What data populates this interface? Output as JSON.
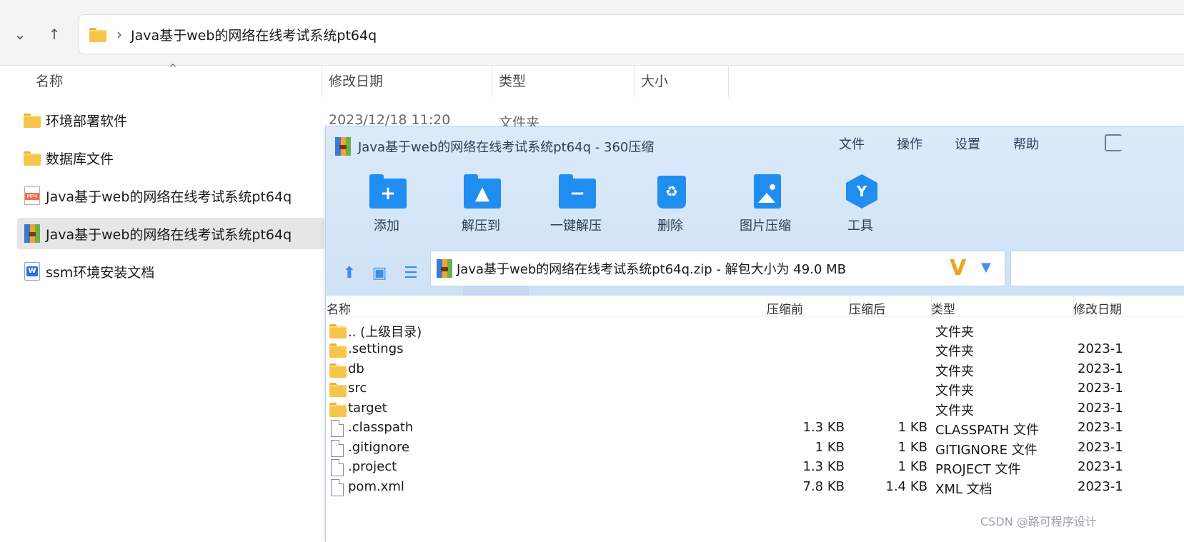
{
  "explorer": {
    "path": "Java基于web的网络在线考试系统pt64q",
    "columns": {
      "name": "名称",
      "modified": "修改日期",
      "type": "类型",
      "size": "大小"
    },
    "items": [
      {
        "name": "环境部署软件",
        "date": "2023/12/18 11:20",
        "type": "文件夹",
        "icon": "folder-icon"
      },
      {
        "name": "数据库文件",
        "icon": "folder-icon"
      },
      {
        "name": "Java基于web的网络在线考试系统pt64q",
        "icon": "mp4-file-icon"
      },
      {
        "name": "Java基于web的网络在线考试系统pt64q",
        "icon": "zip-archive-icon"
      },
      {
        "name": "ssm环境安装文档",
        "icon": "word-doc-icon"
      }
    ]
  },
  "zip": {
    "title": "Java基于web的网络在线考试系统pt64q - 360压缩",
    "menu": [
      "文件",
      "操作",
      "设置",
      "帮助"
    ],
    "tools": [
      {
        "label": "添加",
        "icon": "add-folder-icon"
      },
      {
        "label": "解压到",
        "icon": "extract-to-icon"
      },
      {
        "label": "一键解压",
        "icon": "one-click-extract-icon"
      },
      {
        "label": "删除",
        "icon": "delete-icon"
      },
      {
        "label": "图片压缩",
        "icon": "image-compress-icon"
      },
      {
        "label": "工具",
        "icon": "tools-icon"
      }
    ],
    "path_text": "Java基于web的网络在线考试系统pt64q.zip - 解包大小为 49.0 MB",
    "columns": {
      "name": "名称",
      "before": "压缩前",
      "after": "压缩后",
      "type": "类型",
      "modified": "修改日期"
    },
    "rows": [
      {
        "name": ".. (上级目录)",
        "before": "",
        "after": "",
        "type": "文件夹",
        "date": "",
        "icon": "folder-icon"
      },
      {
        "name": ".settings",
        "before": "",
        "after": "",
        "type": "文件夹",
        "date": "2023-1",
        "icon": "folder-icon"
      },
      {
        "name": "db",
        "before": "",
        "after": "",
        "type": "文件夹",
        "date": "2023-1",
        "icon": "folder-icon"
      },
      {
        "name": "src",
        "before": "",
        "after": "",
        "type": "文件夹",
        "date": "2023-1",
        "icon": "folder-icon"
      },
      {
        "name": "target",
        "before": "",
        "after": "",
        "type": "文件夹",
        "date": "2023-1",
        "icon": "folder-icon"
      },
      {
        "name": ".classpath",
        "before": "1.3 KB",
        "after": "1 KB",
        "type": "CLASSPATH 文件",
        "date": "2023-1",
        "icon": "file-icon"
      },
      {
        "name": ".gitignore",
        "before": "1 KB",
        "after": "1 KB",
        "type": "GITIGNORE 文件",
        "date": "2023-1",
        "icon": "file-icon"
      },
      {
        "name": ".project",
        "before": "1.3 KB",
        "after": "1 KB",
        "type": "PROJECT 文件",
        "date": "2023-1",
        "icon": "file-icon"
      },
      {
        "name": "pom.xml",
        "before": "7.8 KB",
        "after": "1.4 KB",
        "type": "XML 文档",
        "date": "2023-1",
        "icon": "file-icon"
      }
    ]
  },
  "watermark": "CSDN @路可程序设计"
}
